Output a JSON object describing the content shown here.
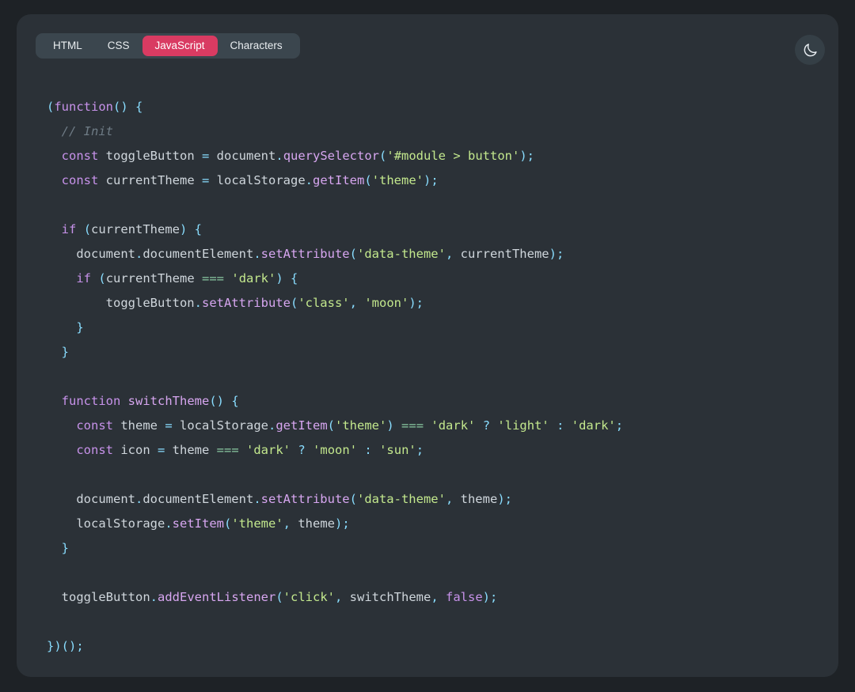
{
  "window": {
    "background_color": "#1e2226",
    "panel_color": "#2b3137"
  },
  "tabs": {
    "items": [
      {
        "label": "HTML",
        "active": false
      },
      {
        "label": "CSS",
        "active": false
      },
      {
        "label": "JavaScript",
        "active": true
      },
      {
        "label": "Characters",
        "active": false
      }
    ],
    "active_color": "#d93b62",
    "bar_color": "#3b464e"
  },
  "theme_toggle": {
    "icon": "moon-icon",
    "title": "Toggle theme"
  },
  "editor": {
    "language": "JavaScript",
    "colors": {
      "keyword": "#c792ea",
      "string": "#c3e88d",
      "punctuation": "#89ddff",
      "comment": "#6e7b85",
      "plain": "#cfd6dc",
      "equality_operator": "#89c8a0"
    },
    "lines": [
      [
        {
          "t": "punc",
          "v": "("
        },
        {
          "t": "kw",
          "v": "function"
        },
        {
          "t": "punc",
          "v": "() {"
        }
      ],
      [
        {
          "t": "plain",
          "v": "  "
        },
        {
          "t": "comment",
          "v": "// Init"
        }
      ],
      [
        {
          "t": "plain",
          "v": "  "
        },
        {
          "t": "kw",
          "v": "const"
        },
        {
          "t": "plain",
          "v": " toggleButton "
        },
        {
          "t": "op",
          "v": "="
        },
        {
          "t": "plain",
          "v": " document"
        },
        {
          "t": "op",
          "v": "."
        },
        {
          "t": "fnname",
          "v": "querySelector"
        },
        {
          "t": "punc",
          "v": "("
        },
        {
          "t": "str",
          "v": "'#module > button'"
        },
        {
          "t": "punc",
          "v": ");"
        }
      ],
      [
        {
          "t": "plain",
          "v": "  "
        },
        {
          "t": "kw",
          "v": "const"
        },
        {
          "t": "plain",
          "v": " currentTheme "
        },
        {
          "t": "op",
          "v": "="
        },
        {
          "t": "plain",
          "v": " localStorage"
        },
        {
          "t": "op",
          "v": "."
        },
        {
          "t": "fnname",
          "v": "getItem"
        },
        {
          "t": "punc",
          "v": "("
        },
        {
          "t": "str",
          "v": "'theme'"
        },
        {
          "t": "punc",
          "v": ");"
        }
      ],
      [],
      [
        {
          "t": "plain",
          "v": "  "
        },
        {
          "t": "kw",
          "v": "if"
        },
        {
          "t": "plain",
          "v": " "
        },
        {
          "t": "punc",
          "v": "("
        },
        {
          "t": "plain",
          "v": "currentTheme"
        },
        {
          "t": "punc",
          "v": ") {"
        }
      ],
      [
        {
          "t": "plain",
          "v": "    document"
        },
        {
          "t": "op",
          "v": "."
        },
        {
          "t": "plain",
          "v": "documentElement"
        },
        {
          "t": "op",
          "v": "."
        },
        {
          "t": "fnname",
          "v": "setAttribute"
        },
        {
          "t": "punc",
          "v": "("
        },
        {
          "t": "str",
          "v": "'data-theme'"
        },
        {
          "t": "punc",
          "v": ","
        },
        {
          "t": "plain",
          "v": " currentTheme"
        },
        {
          "t": "punc",
          "v": ");"
        }
      ],
      [
        {
          "t": "plain",
          "v": "    "
        },
        {
          "t": "kw",
          "v": "if"
        },
        {
          "t": "plain",
          "v": " "
        },
        {
          "t": "punc",
          "v": "("
        },
        {
          "t": "plain",
          "v": "currentTheme "
        },
        {
          "t": "opeq",
          "v": "==="
        },
        {
          "t": "plain",
          "v": " "
        },
        {
          "t": "str",
          "v": "'dark'"
        },
        {
          "t": "punc",
          "v": ") {"
        }
      ],
      [
        {
          "t": "plain",
          "v": "        toggleButton"
        },
        {
          "t": "op",
          "v": "."
        },
        {
          "t": "fnname",
          "v": "setAttribute"
        },
        {
          "t": "punc",
          "v": "("
        },
        {
          "t": "str",
          "v": "'class'"
        },
        {
          "t": "punc",
          "v": ","
        },
        {
          "t": "plain",
          "v": " "
        },
        {
          "t": "str",
          "v": "'moon'"
        },
        {
          "t": "punc",
          "v": ");"
        }
      ],
      [
        {
          "t": "plain",
          "v": "    "
        },
        {
          "t": "punc",
          "v": "}"
        }
      ],
      [
        {
          "t": "plain",
          "v": "  "
        },
        {
          "t": "punc",
          "v": "}"
        }
      ],
      [],
      [
        {
          "t": "plain",
          "v": "  "
        },
        {
          "t": "kw",
          "v": "function"
        },
        {
          "t": "plain",
          "v": " "
        },
        {
          "t": "fnname",
          "v": "switchTheme"
        },
        {
          "t": "punc",
          "v": "() {"
        }
      ],
      [
        {
          "t": "plain",
          "v": "    "
        },
        {
          "t": "kw",
          "v": "const"
        },
        {
          "t": "plain",
          "v": " theme "
        },
        {
          "t": "op",
          "v": "="
        },
        {
          "t": "plain",
          "v": " localStorage"
        },
        {
          "t": "op",
          "v": "."
        },
        {
          "t": "fnname",
          "v": "getItem"
        },
        {
          "t": "punc",
          "v": "("
        },
        {
          "t": "str",
          "v": "'theme'"
        },
        {
          "t": "punc",
          "v": ")"
        },
        {
          "t": "plain",
          "v": " "
        },
        {
          "t": "opeq",
          "v": "==="
        },
        {
          "t": "plain",
          "v": " "
        },
        {
          "t": "str",
          "v": "'dark'"
        },
        {
          "t": "plain",
          "v": " "
        },
        {
          "t": "op",
          "v": "?"
        },
        {
          "t": "plain",
          "v": " "
        },
        {
          "t": "str",
          "v": "'light'"
        },
        {
          "t": "plain",
          "v": " "
        },
        {
          "t": "op",
          "v": ":"
        },
        {
          "t": "plain",
          "v": " "
        },
        {
          "t": "str",
          "v": "'dark'"
        },
        {
          "t": "punc",
          "v": ";"
        }
      ],
      [
        {
          "t": "plain",
          "v": "    "
        },
        {
          "t": "kw",
          "v": "const"
        },
        {
          "t": "plain",
          "v": " icon "
        },
        {
          "t": "op",
          "v": "="
        },
        {
          "t": "plain",
          "v": " theme "
        },
        {
          "t": "opeq",
          "v": "==="
        },
        {
          "t": "plain",
          "v": " "
        },
        {
          "t": "str",
          "v": "'dark'"
        },
        {
          "t": "plain",
          "v": " "
        },
        {
          "t": "op",
          "v": "?"
        },
        {
          "t": "plain",
          "v": " "
        },
        {
          "t": "str",
          "v": "'moon'"
        },
        {
          "t": "plain",
          "v": " "
        },
        {
          "t": "op",
          "v": ":"
        },
        {
          "t": "plain",
          "v": " "
        },
        {
          "t": "str",
          "v": "'sun'"
        },
        {
          "t": "punc",
          "v": ";"
        }
      ],
      [],
      [
        {
          "t": "plain",
          "v": "    document"
        },
        {
          "t": "op",
          "v": "."
        },
        {
          "t": "plain",
          "v": "documentElement"
        },
        {
          "t": "op",
          "v": "."
        },
        {
          "t": "fnname",
          "v": "setAttribute"
        },
        {
          "t": "punc",
          "v": "("
        },
        {
          "t": "str",
          "v": "'data-theme'"
        },
        {
          "t": "punc",
          "v": ","
        },
        {
          "t": "plain",
          "v": " theme"
        },
        {
          "t": "punc",
          "v": ");"
        }
      ],
      [
        {
          "t": "plain",
          "v": "    localStorage"
        },
        {
          "t": "op",
          "v": "."
        },
        {
          "t": "fnname",
          "v": "setItem"
        },
        {
          "t": "punc",
          "v": "("
        },
        {
          "t": "str",
          "v": "'theme'"
        },
        {
          "t": "punc",
          "v": ","
        },
        {
          "t": "plain",
          "v": " theme"
        },
        {
          "t": "punc",
          "v": ");"
        }
      ],
      [
        {
          "t": "plain",
          "v": "  "
        },
        {
          "t": "punc",
          "v": "}"
        }
      ],
      [],
      [
        {
          "t": "plain",
          "v": "  toggleButton"
        },
        {
          "t": "op",
          "v": "."
        },
        {
          "t": "fnname",
          "v": "addEventListener"
        },
        {
          "t": "punc",
          "v": "("
        },
        {
          "t": "str",
          "v": "'click'"
        },
        {
          "t": "punc",
          "v": ","
        },
        {
          "t": "plain",
          "v": " switchTheme"
        },
        {
          "t": "punc",
          "v": ","
        },
        {
          "t": "plain",
          "v": " "
        },
        {
          "t": "kw",
          "v": "false"
        },
        {
          "t": "punc",
          "v": ");"
        }
      ],
      [],
      [
        {
          "t": "punc",
          "v": "})();"
        }
      ]
    ]
  }
}
